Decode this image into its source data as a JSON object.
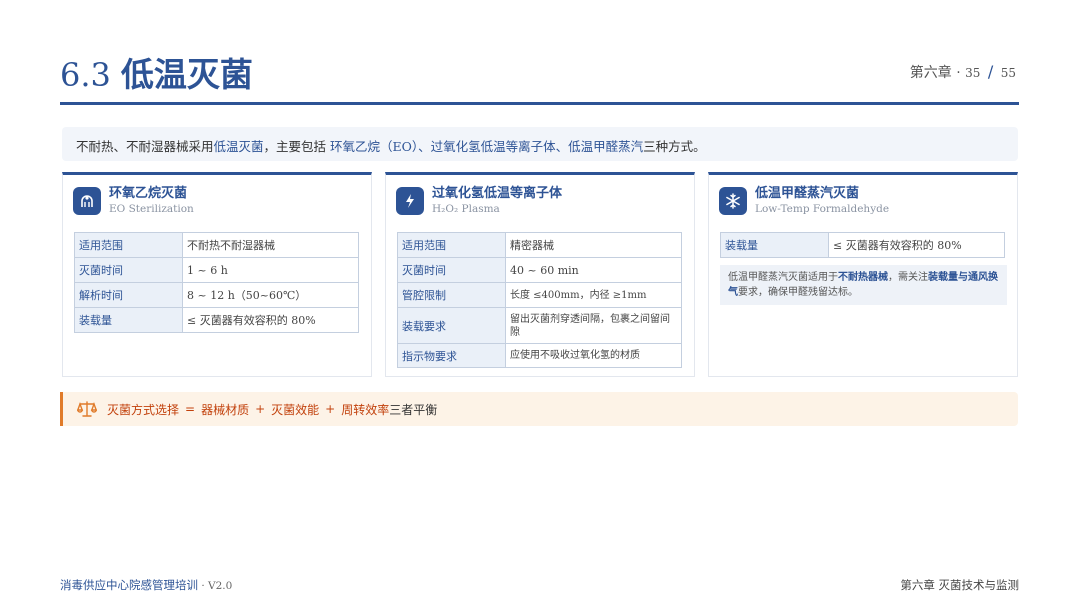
{
  "header": {
    "number": "6.3",
    "title": "低温灭菌",
    "chapter": "第六章",
    "dot": "·",
    "page": "35",
    "slash": "/",
    "total": "55"
  },
  "intro": {
    "part1": "不耐热、不耐湿器械采用",
    "highlight1": "低温灭菌",
    "part2": "，主要包括 ",
    "highlight2": "环氧乙烷（EO）、过氧化氢低温等离子体、低温甲醛蒸汽",
    "part3": "三种方式。"
  },
  "cards": [
    {
      "title": "环氧乙烷灭菌",
      "subtitle": "EO Sterilization",
      "icon": "flask-icon",
      "rows": [
        {
          "k": "适用范围",
          "v": "不耐热不耐湿器械"
        },
        {
          "k": "灭菌时间",
          "v": "1 ~ 6 h"
        },
        {
          "k": "解析时间",
          "v": "8 ~ 12 h（50~60℃）"
        },
        {
          "k": "装载量",
          "v": "≤ 灭菌器有效容积的 80%"
        }
      ]
    },
    {
      "title": "过氧化氢低温等离子体",
      "subtitle": "H₂O₂ Plasma",
      "icon": "lightning-icon",
      "rows": [
        {
          "k": "适用范围",
          "v": "精密器械"
        },
        {
          "k": "灭菌时间",
          "v": "40 ~ 60 min"
        },
        {
          "k": "管腔限制",
          "v": "长度 ≤400mm，内径 ≥1mm"
        },
        {
          "k": "装载要求",
          "v": "留出灭菌剂穿透间隔，包裹之间留间隙"
        },
        {
          "k": "指示物要求",
          "v": "应使用不吸收过氧化氢的材质"
        }
      ]
    },
    {
      "title": "低温甲醛蒸汽灭菌",
      "subtitle": "Low-Temp Formaldehyde",
      "icon": "snowflake-icon",
      "rows": [
        {
          "k": "装载量",
          "v": "≤ 灭菌器有效容积的 80%"
        }
      ],
      "note": {
        "part1": "低温甲醛蒸汽灭菌适用于",
        "highlight1": "不耐热器械",
        "part2": "，需关注",
        "highlight2": "装载量与通风换气",
        "part3": "要求，确保甲醛残留达标。"
      }
    }
  ],
  "summary": {
    "icon": "balance-scale-icon",
    "label": "灭菌方式选择",
    "eq": "=",
    "item1": "器械材质",
    "plus1": "+",
    "item2": "灭菌效能",
    "plus2": "+",
    "item3": "周转效率",
    "tail": "三者平衡"
  },
  "footer": {
    "left": "消毒供应中心院感管理培训",
    "dot": " · ",
    "version": "V2.0",
    "right": "第六章  灭菌技术与监测"
  },
  "colors": {
    "primary": "#2d5395",
    "accent": "#e07b2a",
    "accent_text": "#c2410c"
  }
}
